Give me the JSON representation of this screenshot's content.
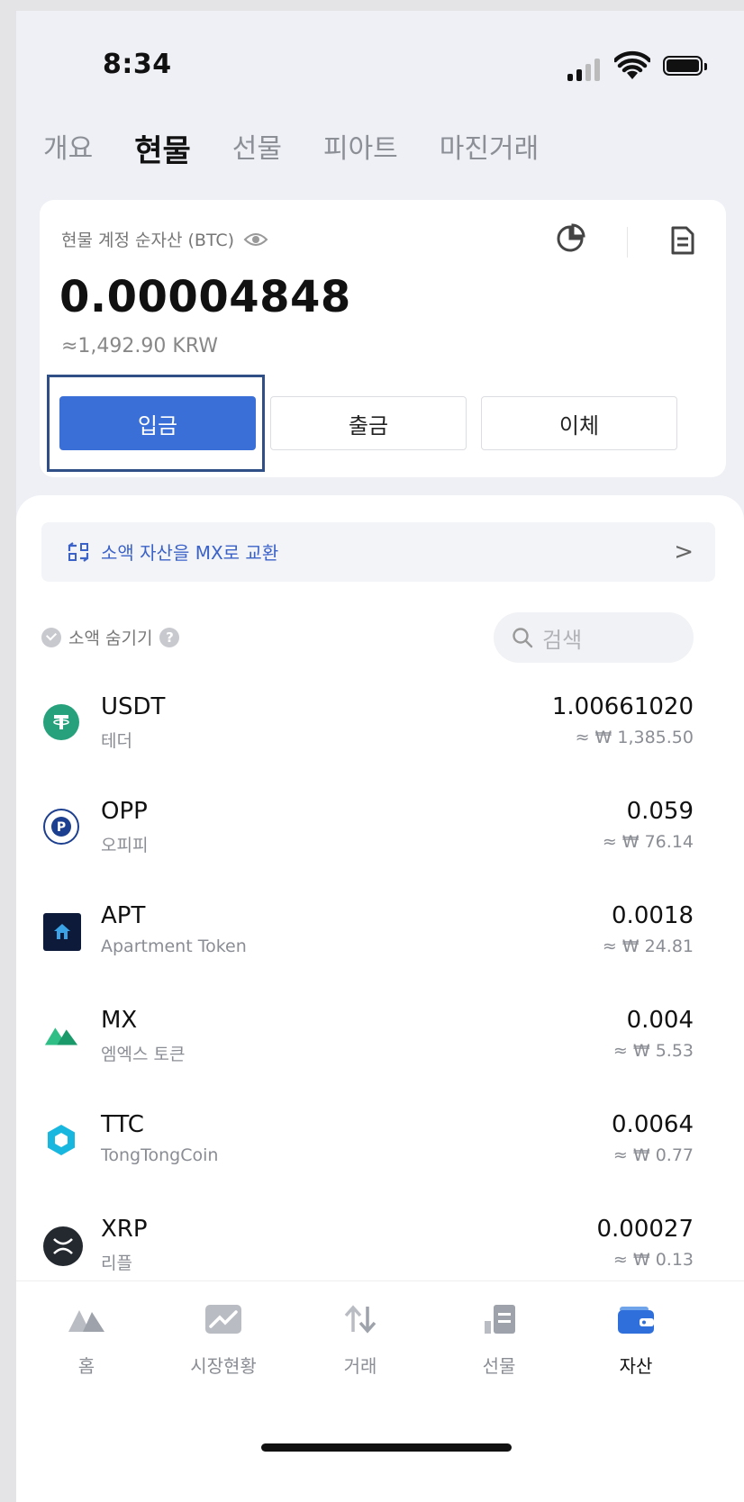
{
  "status_bar": {
    "time": "8:34"
  },
  "tabs": [
    {
      "label": "개요",
      "active": false
    },
    {
      "label": "현물",
      "active": true
    },
    {
      "label": "선물",
      "active": false
    },
    {
      "label": "피아트",
      "active": false
    },
    {
      "label": "마진거래",
      "active": false
    }
  ],
  "account": {
    "label": "현물 계정 순자산 (BTC)",
    "balance": "0.00004848",
    "krw_equivalent": "≈1,492.90 KRW",
    "deposit_label": "입금",
    "withdraw_label": "출금",
    "transfer_label": "이체"
  },
  "convert_banner": {
    "text": "소액 자산을 MX로 교환"
  },
  "filters": {
    "hide_small_label": "소액 숨기기",
    "search_placeholder": "검색"
  },
  "assets": [
    {
      "symbol": "USDT",
      "name": "테더",
      "amount": "1.00661020",
      "fiat": "≈ ₩ 1,385.50",
      "icon": "tether-icon",
      "color": "#26a17b"
    },
    {
      "symbol": "OPP",
      "name": "오피피",
      "amount": "0.059",
      "fiat": "≈ ₩ 76.14",
      "icon": "opp-icon",
      "color": "#1d3f8f"
    },
    {
      "symbol": "APT",
      "name": "Apartment Token",
      "amount": "0.0018",
      "fiat": "≈ ₩ 24.81",
      "icon": "apt-icon",
      "color": "#0e1a3a"
    },
    {
      "symbol": "MX",
      "name": "엠엑스 토큰",
      "amount": "0.004",
      "fiat": "≈ ₩ 5.53",
      "icon": "mx-icon",
      "color": "#2fbf86"
    },
    {
      "symbol": "TTC",
      "name": "TongTongCoin",
      "amount": "0.0064",
      "fiat": "≈ ₩ 0.77",
      "icon": "ttc-icon",
      "color": "#18b7e0"
    },
    {
      "symbol": "XRP",
      "name": "리플",
      "amount": "0.00027",
      "fiat": "≈ ₩ 0.13",
      "icon": "xrp-icon",
      "color": "#23292f"
    }
  ],
  "bottom_nav": [
    {
      "label": "홈",
      "icon": "home-icon",
      "active": false
    },
    {
      "label": "시장현황",
      "icon": "market-icon",
      "active": false
    },
    {
      "label": "거래",
      "icon": "trade-icon",
      "active": false
    },
    {
      "label": "선물",
      "icon": "futures-icon",
      "active": false
    },
    {
      "label": "자산",
      "icon": "wallet-icon",
      "active": true
    }
  ]
}
